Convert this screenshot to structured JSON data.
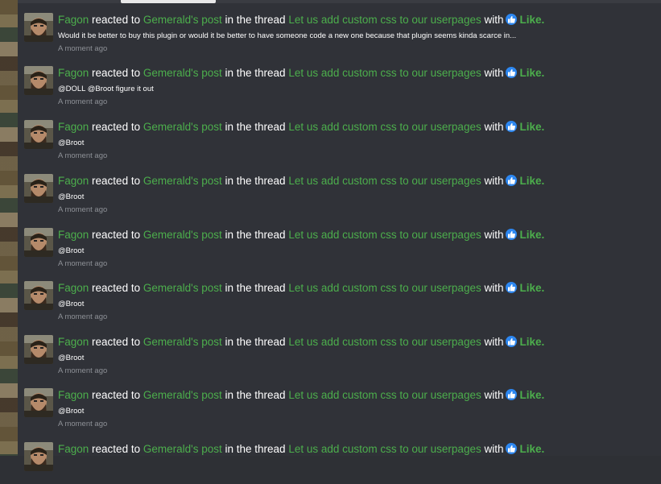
{
  "alerts": [
    {
      "user": "Fagon",
      "reacted_to": "reacted to",
      "post_owner": "Gemerald's post",
      "in_thread": "in the thread",
      "thread": "Let us add custom css to our userpages",
      "with": "with",
      "reaction": "Like.",
      "snippet": "Would it be better to buy this plugin or would it be better to have someone code a new one because that plugin seems kinda scarce in...",
      "time": "A moment ago"
    },
    {
      "user": "Fagon",
      "reacted_to": "reacted to",
      "post_owner": "Gemerald's post",
      "in_thread": "in the thread",
      "thread": "Let us add custom css to our userpages",
      "with": "with",
      "reaction": "Like.",
      "snippet": "@DOLL @Broot figure it out",
      "time": "A moment ago"
    },
    {
      "user": "Fagon",
      "reacted_to": "reacted to",
      "post_owner": "Gemerald's post",
      "in_thread": "in the thread",
      "thread": "Let us add custom css to our userpages",
      "with": "with",
      "reaction": "Like.",
      "snippet": "@Broot",
      "time": "A moment ago"
    },
    {
      "user": "Fagon",
      "reacted_to": "reacted to",
      "post_owner": "Gemerald's post",
      "in_thread": "in the thread",
      "thread": "Let us add custom css to our userpages",
      "with": "with",
      "reaction": "Like.",
      "snippet": "@Broot",
      "time": "A moment ago"
    },
    {
      "user": "Fagon",
      "reacted_to": "reacted to",
      "post_owner": "Gemerald's post",
      "in_thread": "in the thread",
      "thread": "Let us add custom css to our userpages",
      "with": "with",
      "reaction": "Like.",
      "snippet": "@Broot",
      "time": "A moment ago"
    },
    {
      "user": "Fagon",
      "reacted_to": "reacted to",
      "post_owner": "Gemerald's post",
      "in_thread": "in the thread",
      "thread": "Let us add custom css to our userpages",
      "with": "with",
      "reaction": "Like.",
      "snippet": "@Broot",
      "time": "A moment ago"
    },
    {
      "user": "Fagon",
      "reacted_to": "reacted to",
      "post_owner": "Gemerald's post",
      "in_thread": "in the thread",
      "thread": "Let us add custom css to our userpages",
      "with": "with",
      "reaction": "Like.",
      "snippet": "@Broot",
      "time": "A moment ago"
    },
    {
      "user": "Fagon",
      "reacted_to": "reacted to",
      "post_owner": "Gemerald's post",
      "in_thread": "in the thread",
      "thread": "Let us add custom css to our userpages",
      "with": "with",
      "reaction": "Like.",
      "snippet": "@Broot",
      "time": "A moment ago"
    },
    {
      "user": "Fagon",
      "reacted_to": "reacted to",
      "post_owner": "Gemerald's post",
      "in_thread": "in the thread",
      "thread": "Let us add custom css to our userpages",
      "with": "with",
      "reaction": "Like.",
      "snippet": "",
      "time": ""
    }
  ],
  "colors": {
    "background": "#303238",
    "link_green": "#4cae4c",
    "like_blue": "#2d87f0",
    "muted": "#8d9096"
  },
  "icons": {
    "reaction": "thumbs-up-icon"
  }
}
